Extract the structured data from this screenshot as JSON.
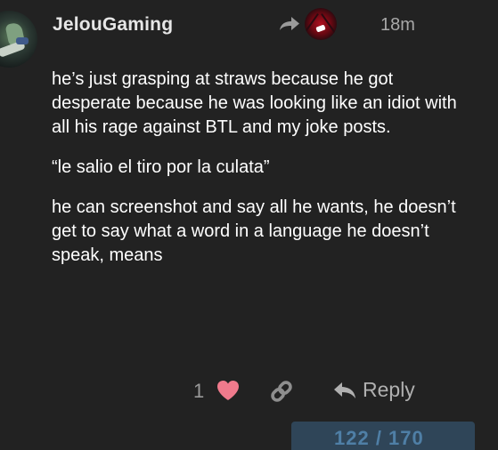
{
  "post": {
    "username": "JelouGaming",
    "timestamp": "18m",
    "paragraphs": [
      "he’s just grasping at straws because he got desperate because he was looking like an idiot with all his rage against BTL and my joke posts.",
      "“le salio el tiro por la culata”",
      "he can screenshot and say all he wants, he doesn’t get to say what a word in a language he doesn’t speak, means"
    ]
  },
  "actions": {
    "like_count": "1",
    "reply_label": "Reply"
  },
  "timeline": {
    "progress_text": "122 / 170"
  },
  "icons": {
    "share": "share-arrow-icon",
    "heart": "heart-icon",
    "link": "link-icon",
    "reply": "reply-arrow-icon"
  },
  "colors": {
    "background": "#222222",
    "heart": "#f07a8c",
    "muted": "#a8a8a8",
    "progress_bg": "#2f4558",
    "progress_text": "#4f7fa6"
  }
}
